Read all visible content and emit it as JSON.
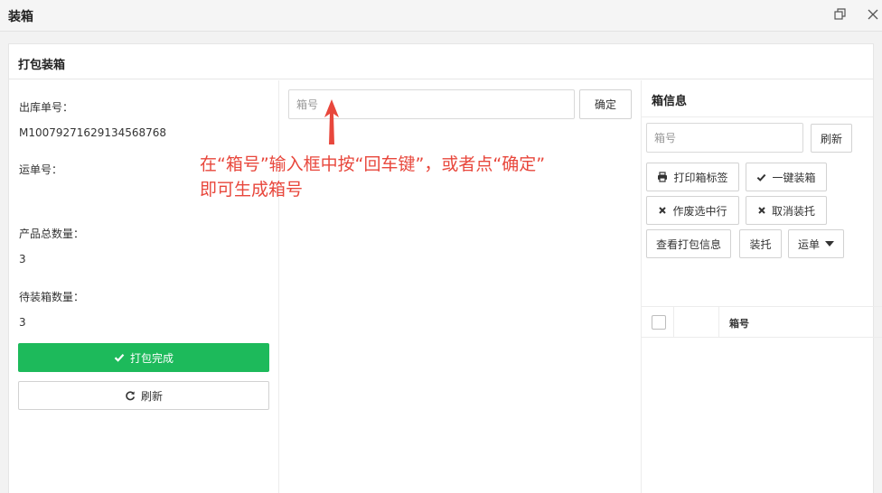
{
  "window": {
    "title": "装箱",
    "restore_icon": "restore-icon",
    "close_icon": "close-icon"
  },
  "panel": {
    "title": "打包装箱"
  },
  "left": {
    "order_label": "出库单号：",
    "order_value": "M1007927162913456876 8",
    "waybill_label": "运单号：",
    "waybill_value": "",
    "total_qty_label": "产品总数量：",
    "total_qty_value": "3",
    "pending_qty_label": "待装箱数量：",
    "pending_qty_value": "3",
    "finish_button": "打包完成",
    "refresh_button": "刷新"
  },
  "middle": {
    "box_input_placeholder": "箱号",
    "box_input_value": "",
    "confirm_button": "确定",
    "annotation_line1": "在“箱号”输入框中按“回车键”，或者点“确定”",
    "annotation_line2": "即可生成箱号"
  },
  "right": {
    "title": "箱信息",
    "search_placeholder": "箱号",
    "refresh_button": "刷新",
    "print_label_button": "打印箱标签",
    "one_click_button": "一键装箱",
    "void_rows_button": "作废选中行",
    "cancel_packing_button": "取消装托",
    "view_pack_info_button": "查看打包信息",
    "palletize_button": "装托",
    "waybill_dropdown": "运单",
    "table_headers": [
      "箱号"
    ]
  },
  "colors": {
    "accent_green": "#1dba5b",
    "annotation_red": "#e8473c"
  }
}
